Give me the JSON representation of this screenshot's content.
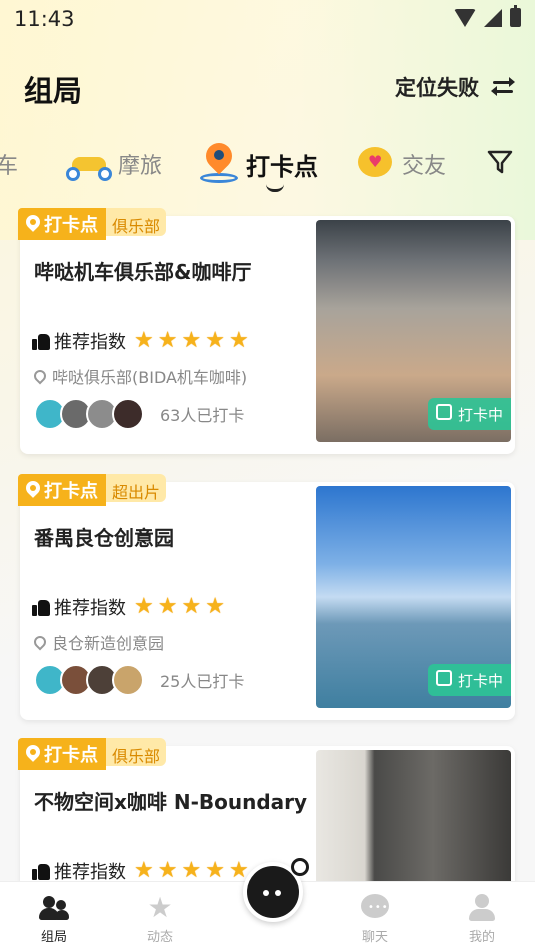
{
  "status_bar": {
    "time": "11:43"
  },
  "header": {
    "title": "组局",
    "location_status": "定位失败"
  },
  "tabs": [
    {
      "label": "车",
      "icon": "scooter-icon"
    },
    {
      "label": "摩旅",
      "icon": "scooter-icon"
    },
    {
      "label": "打卡点",
      "icon": "map-pin-icon",
      "active": true
    },
    {
      "label": "交友",
      "icon": "heart-bubble-icon"
    }
  ],
  "cards": [
    {
      "badge": "打卡点",
      "tag": "俱乐部",
      "title": "哔哒机车俱乐部&咖啡厅",
      "rec_label": "推荐指数",
      "stars": 5,
      "address": "哔哒俱乐部(BIDA机车咖啡)",
      "checkins": "63人已打卡",
      "photo_tag": "打卡中",
      "avatar_colors": [
        "#3fb6c9",
        "#6a6a6a",
        "#8c8c8c",
        "#3d2c2a"
      ]
    },
    {
      "badge": "打卡点",
      "tag": "超出片",
      "title": "番禺良仓创意园",
      "rec_label": "推荐指数",
      "stars": 4,
      "address": "良仓新造创意园",
      "checkins": "25人已打卡",
      "photo_tag": "打卡中",
      "avatar_colors": [
        "#3fb6c9",
        "#7a4f3a",
        "#4d4038",
        "#c9a46b"
      ]
    },
    {
      "badge": "打卡点",
      "tag": "俱乐部",
      "title": "不物空间x咖啡 N-Boundary",
      "rec_label": "推荐指数",
      "stars": 5
    }
  ],
  "bottom_nav": {
    "home": "组局",
    "feed": "动态",
    "chat": "聊天",
    "me": "我的"
  },
  "colors": {
    "accent": "#f6b21b",
    "tag_green": "#2cc496"
  }
}
